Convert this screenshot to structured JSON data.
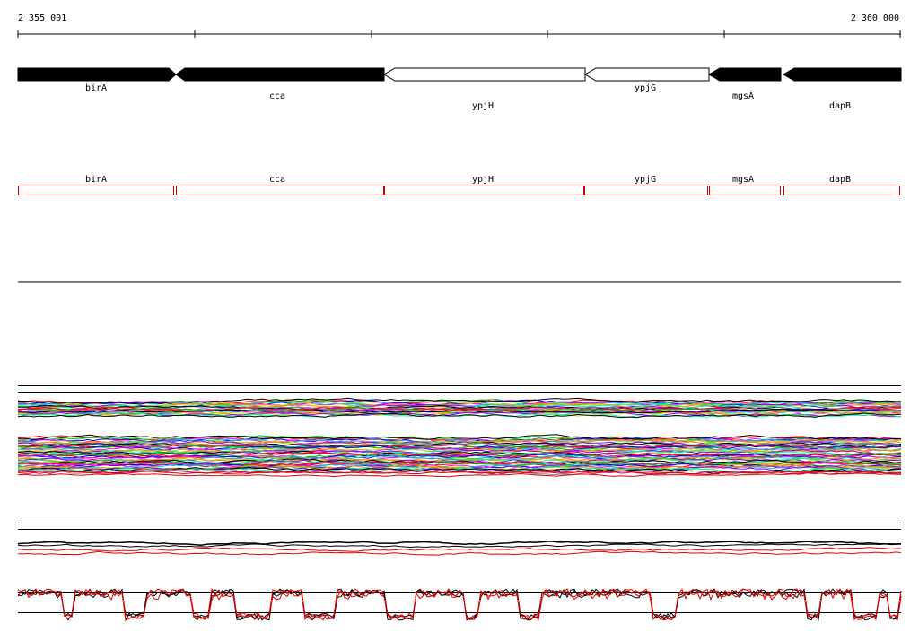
{
  "ruler": {
    "start_label": "2 355 001",
    "end_label": "2 360 000",
    "start": 2355001,
    "end": 2360000
  },
  "genes": [
    {
      "name": "birA",
      "strand": "+",
      "fill": "#000000"
    },
    {
      "name": "cca",
      "strand": "-",
      "fill": "#000000"
    },
    {
      "name": "ypjH",
      "strand": "-",
      "fill": "#ffffff"
    },
    {
      "name": "ypjG",
      "strand": "-",
      "fill": "#ffffff"
    },
    {
      "name": "mgsA",
      "strand": "-",
      "fill": "#000000"
    },
    {
      "name": "dapB",
      "strand": "-",
      "fill": "#000000"
    }
  ],
  "features": [
    {
      "name": "birA"
    },
    {
      "name": "cca"
    },
    {
      "name": "ypjH"
    },
    {
      "name": "ypjG"
    },
    {
      "name": "mgsA"
    },
    {
      "name": "dapB"
    }
  ],
  "colors": {
    "gene_stroke": "#000000",
    "feature_stroke": "#cc0000",
    "track_line": "#000000",
    "signal_red": "#e00000",
    "signal_black": "#000000"
  }
}
